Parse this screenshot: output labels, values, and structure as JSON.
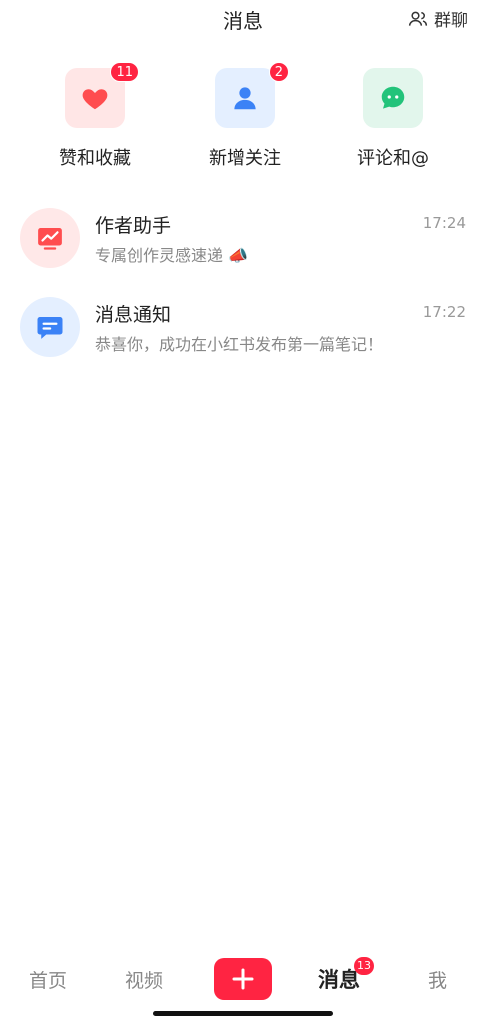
{
  "header": {
    "title": "消息",
    "group_chat_label": "群聊"
  },
  "quick_actions": [
    {
      "label": "赞和收藏",
      "badge": "11",
      "icon": "heart-icon",
      "color": "#ff4d4f"
    },
    {
      "label": "新增关注",
      "badge": "2",
      "icon": "person-icon",
      "color": "#3b82f6"
    },
    {
      "label": "评论和@",
      "badge": "",
      "icon": "chat-bubble-icon",
      "color": "#22c37a"
    }
  ],
  "messages": [
    {
      "name": "作者助手",
      "time": "17:24",
      "preview": "专属创作灵感速递 📣",
      "icon": "chart-board-icon"
    },
    {
      "name": "消息通知",
      "time": "17:22",
      "preview": "恭喜你，成功在小红书发布第一篇笔记！",
      "icon": "message-icon"
    }
  ],
  "bottom_nav": {
    "home": "首页",
    "video": "视频",
    "post_icon": "plus-icon",
    "messages": "消息",
    "messages_badge": "13",
    "me": "我"
  },
  "colors": {
    "accent": "#ff2442"
  }
}
